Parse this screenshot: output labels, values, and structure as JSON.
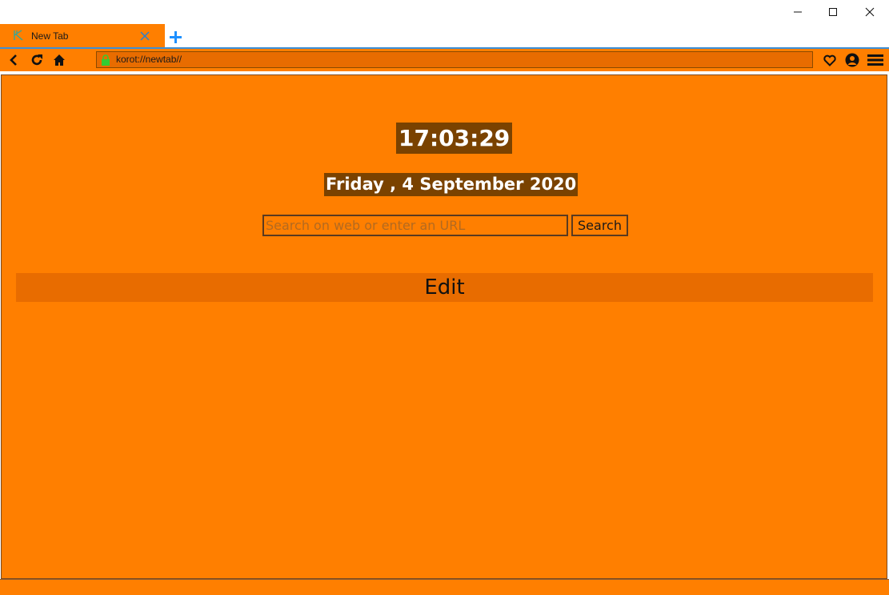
{
  "window": {
    "controls": {
      "minimize_icon": "minimize-icon",
      "maximize_icon": "maximize-icon",
      "close_icon": "close-icon"
    }
  },
  "tabs": [
    {
      "title": "New Tab",
      "active": true,
      "icon": "korot-logo-icon"
    }
  ],
  "toolbar": {
    "address": "korot://newtab//",
    "secure": true
  },
  "page": {
    "time": "17:03:29",
    "date": "Friday , 4 September 2020",
    "search_placeholder": "Search on web or enter an URL",
    "search_value": "",
    "search_button": "Search",
    "edit_label": "Edit"
  },
  "colors": {
    "accent": "#ff7f00",
    "accent_dark": "#e86c00",
    "clock_bg": "#7a4200",
    "tab_divider": "#3d8fd6",
    "new_tab_plus": "#1e90ff"
  }
}
